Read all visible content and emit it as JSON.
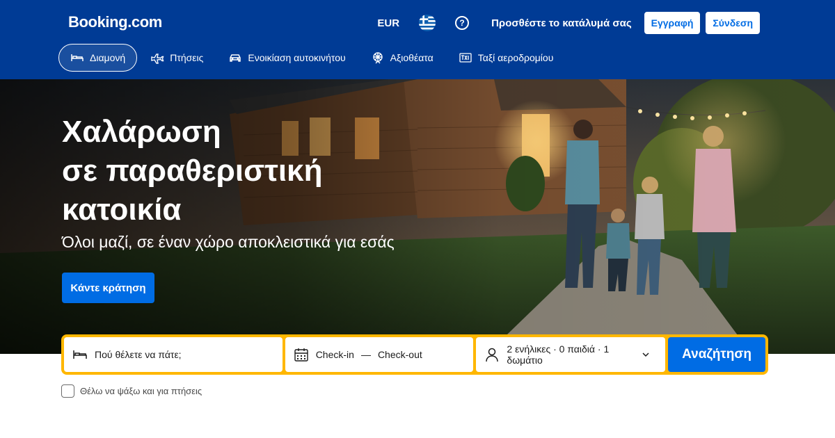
{
  "header": {
    "logo": "Booking.com",
    "currency": "EUR",
    "language_flag": "greece-flag-icon",
    "help_icon": "help-icon",
    "list_property": "Προσθέστε το κατάλυμά σας",
    "register": "Εγγραφή",
    "sign_in": "Σύνδεση"
  },
  "nav": [
    {
      "label": "Διαμονή",
      "icon": "bed-icon",
      "active": true
    },
    {
      "label": "Πτήσεις",
      "icon": "airplane-icon",
      "active": false
    },
    {
      "label": "Ενοικίαση αυτοκινήτου",
      "icon": "car-icon",
      "active": false
    },
    {
      "label": "Αξιοθέατα",
      "icon": "attractions-icon",
      "active": false
    },
    {
      "label": "Ταξί αεροδρομίου",
      "icon": "taxi-icon",
      "active": false
    }
  ],
  "hero": {
    "title_lines": [
      "Χαλάρωση",
      "σε παραθεριστική",
      "κατοικία"
    ],
    "subtitle": "Όλοι μαζί, σε έναν χώρο αποκλειστικά για εσάς",
    "cta": "Κάντε κράτηση"
  },
  "search": {
    "destination_placeholder": "Πού θέλετε να πάτε;",
    "checkin": "Check-in",
    "dash": "—",
    "checkout": "Check-out",
    "occupancy": "2 ενήλικες · 0 παιδιά · 1 δωμάτιο",
    "button": "Αναζήτηση",
    "flights_checkbox": "Θέλω να ψάξω και για πτήσεις"
  },
  "colors": {
    "brand_blue": "#003b95",
    "action_blue": "#006ce4",
    "search_border": "#ffb700"
  }
}
